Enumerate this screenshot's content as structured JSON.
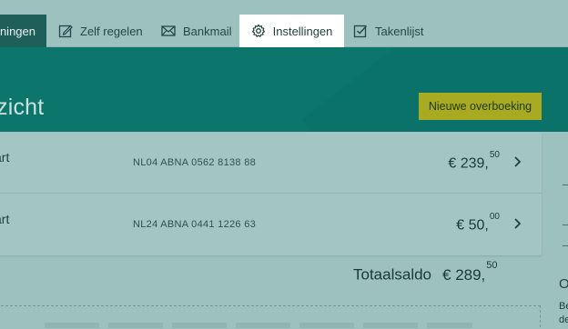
{
  "nav": {
    "tabs": [
      {
        "label": "eningen",
        "icon": null
      },
      {
        "label": "Zelf regelen",
        "icon": "edit-square-icon"
      },
      {
        "label": "Bankmail",
        "icon": "envelope-icon"
      },
      {
        "label": "Instellingen",
        "icon": "gear-icon"
      },
      {
        "label": "Takenlijst",
        "icon": "checkbox-icon"
      }
    ],
    "active_tab": "Instellingen"
  },
  "header": {
    "title": "zicht",
    "new_transfer_label": "Nieuwe overboeking"
  },
  "accounts": [
    {
      "name": "art",
      "iban": "NL04 ABNA 0562 8138 88",
      "amount_main": "€ 239,",
      "amount_cents": "50"
    },
    {
      "name": "art",
      "iban": "NL24 ABNA 0441 1226 63",
      "amount_main": "€ 50,",
      "amount_cents": "00"
    }
  ],
  "total": {
    "label": "Totaalsaldo",
    "amount_main": "€ 289,",
    "amount_cents": "50"
  },
  "side": {
    "heading_fragment": "O",
    "text_fragment_1": "Be",
    "text_fragment_2": "de"
  },
  "colors": {
    "band": "#0c756c",
    "active_tab_bg": "#ffffff",
    "accent_button": "#a8ab21",
    "first_tab_bg": "#1e5f59"
  }
}
